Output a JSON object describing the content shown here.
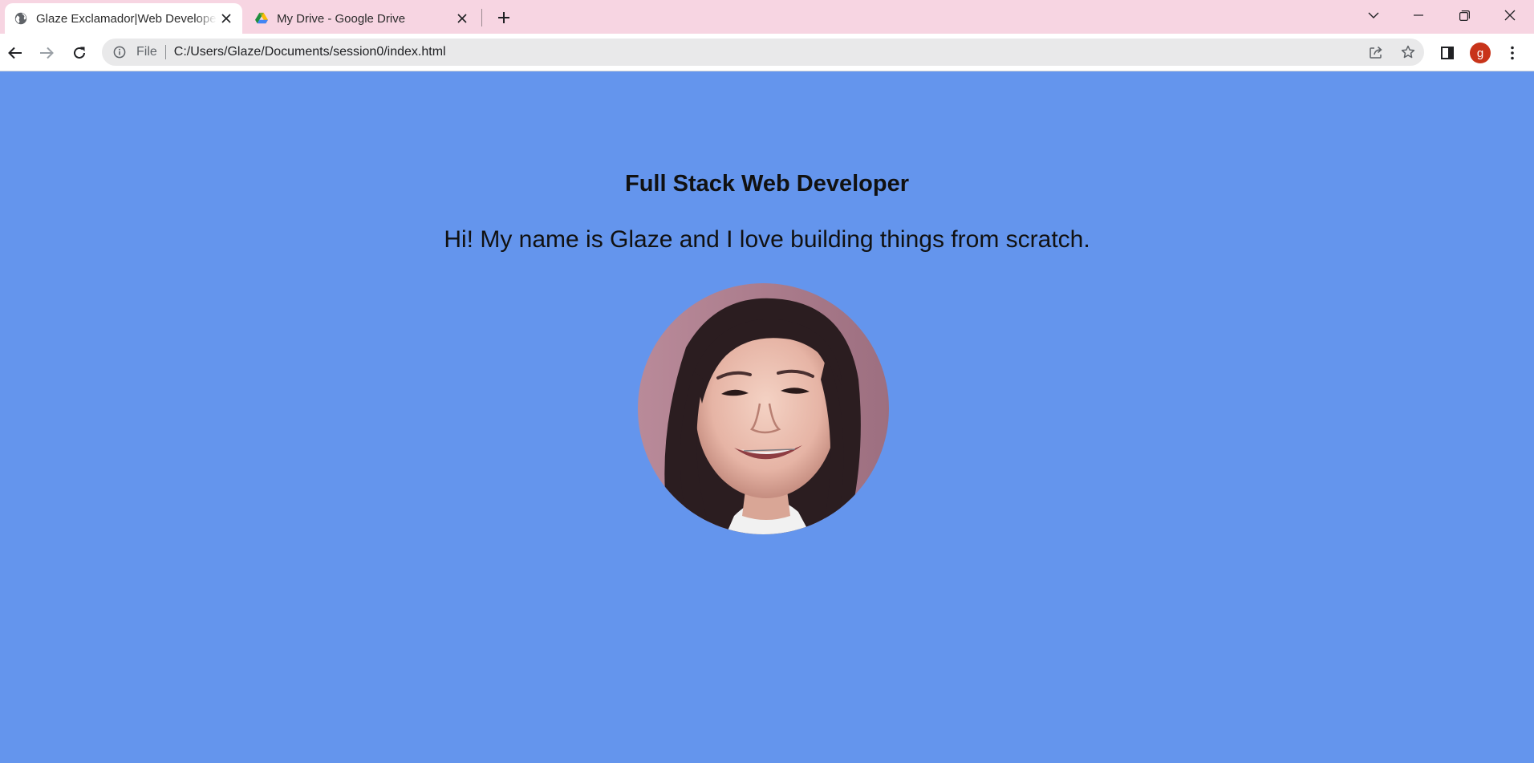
{
  "browser": {
    "tabs": [
      {
        "title": "Glaze Exclamador|Web Developer",
        "favicon": "globe-icon",
        "active": true
      },
      {
        "title": "My Drive - Google Drive",
        "favicon": "google-drive-icon",
        "active": false
      }
    ],
    "address": {
      "scheme_label": "File",
      "url": "C:/Users/Glaze/Documents/session0/index.html"
    },
    "profile_initial": "g",
    "colors": {
      "tabstrip": "#f7d5e2",
      "avatar": "#c8341a"
    }
  },
  "page": {
    "background": "#6495ed",
    "headline": "Full Stack Web Developer",
    "intro": "Hi! My name is Glaze and I love building things from scratch.",
    "photo_alt": "profile-photo"
  }
}
